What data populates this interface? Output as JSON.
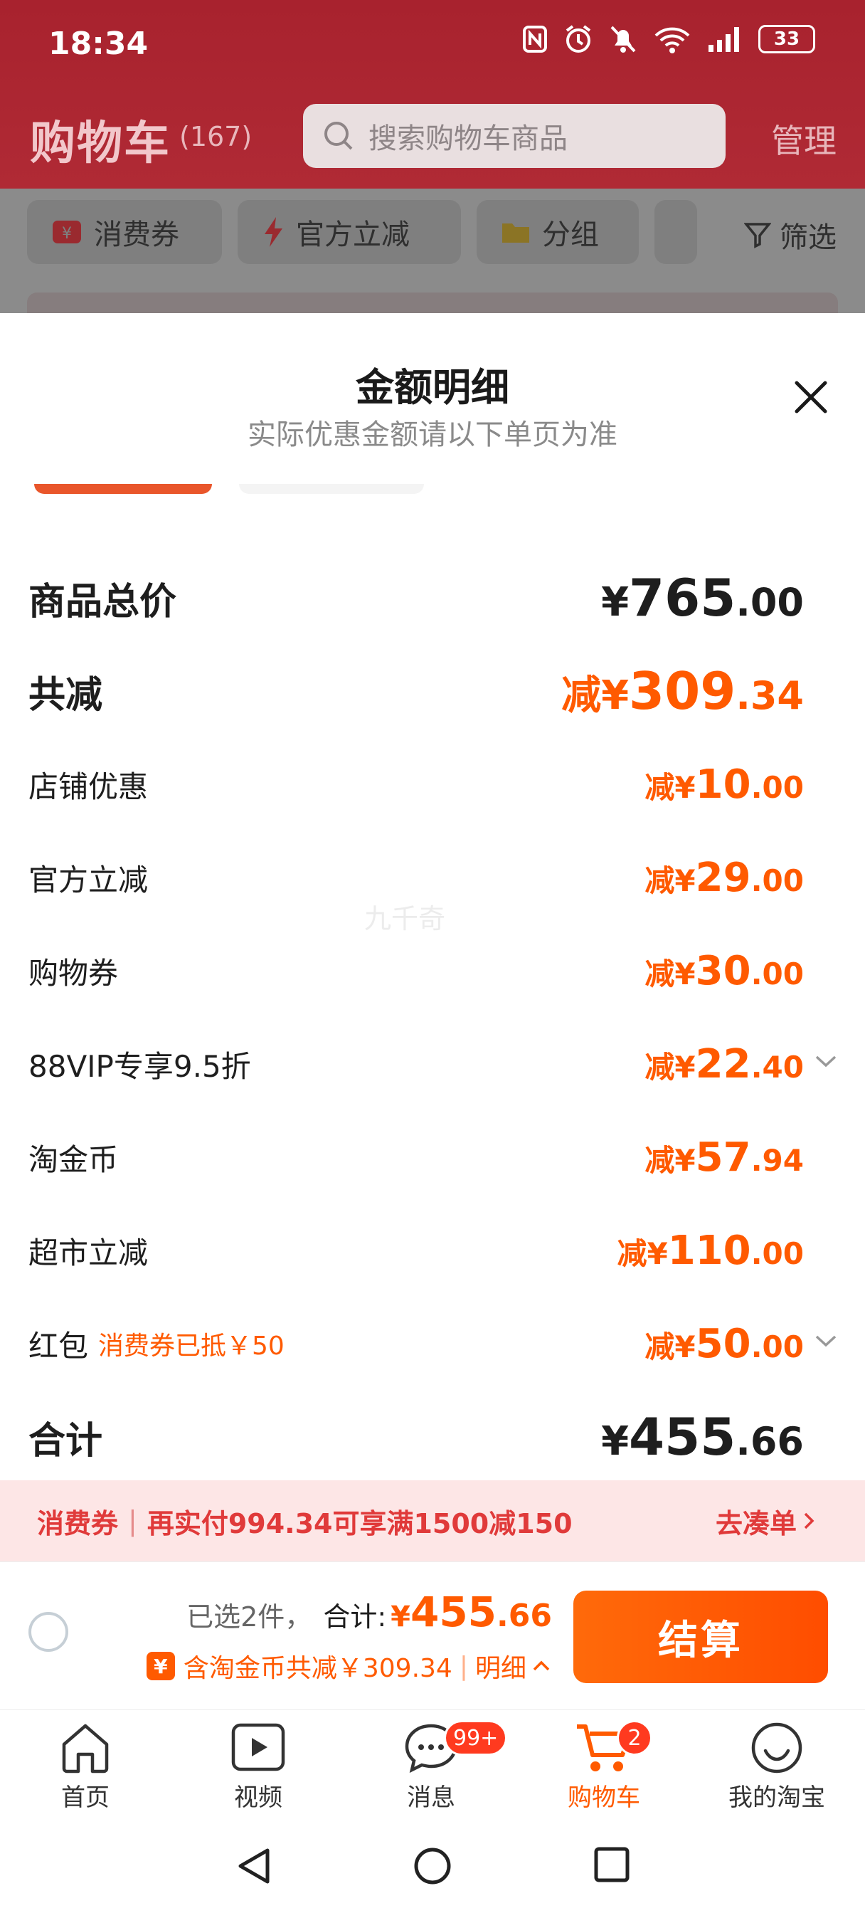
{
  "status_bar": {
    "time": "18:34",
    "battery": "33"
  },
  "header": {
    "title": "购物车",
    "count": "(167)",
    "search_placeholder": "搜索购物车商品",
    "manage": "管理"
  },
  "filters": [
    {
      "label": "消费券",
      "icon": "coupon-icon"
    },
    {
      "label": "官方立减",
      "icon": "lightning-icon"
    },
    {
      "label": "分组",
      "icon": "folder-icon"
    }
  ],
  "filter_right": "筛选",
  "sheet": {
    "title": "金额明细",
    "subtitle": "实际优惠金额请以下单页为准",
    "watermark": "九千奇",
    "rows": [
      {
        "label": "商品总价",
        "prefix": "¥",
        "int": "765",
        "dec": ".00"
      },
      {
        "label": "共减",
        "prefix": "减¥",
        "int": "309",
        "dec": ".34"
      },
      {
        "label": "店铺优惠",
        "prefix": "减¥",
        "int": "10",
        "dec": ".00"
      },
      {
        "label": "官方立减",
        "prefix": "减¥",
        "int": "29",
        "dec": ".00"
      },
      {
        "label": "购物券",
        "prefix": "减¥",
        "int": "30",
        "dec": ".00"
      },
      {
        "label": "88VIP专享9.5折",
        "prefix": "减¥",
        "int": "22",
        "dec": ".40"
      },
      {
        "label": "淘金币",
        "prefix": "减¥",
        "int": "57",
        "dec": ".94"
      },
      {
        "label": "超市立减",
        "prefix": "减¥",
        "int": "110",
        "dec": ".00"
      },
      {
        "label": "红包",
        "note": "消费券已抵￥50",
        "prefix": "减¥",
        "int": "50",
        "dec": ".00"
      },
      {
        "label": "合计",
        "prefix": "¥",
        "int": "455",
        "dec": ".66"
      }
    ]
  },
  "promo": {
    "label": "消费券",
    "text": "再实付994.34可享满1500减150",
    "action": "去凑单"
  },
  "checkout": {
    "selected": "已选2件，",
    "total_label": "合计:",
    "total_prefix": "¥",
    "total_int": "455",
    "total_dec": ".66",
    "badge": "¥",
    "discount_text": "含淘金币共减￥309.34",
    "detail": "明细",
    "button": "结算"
  },
  "tabs": [
    {
      "label": "首页",
      "icon": "home-icon"
    },
    {
      "label": "视频",
      "icon": "video-icon"
    },
    {
      "label": "消息",
      "icon": "message-icon",
      "badge": "99+"
    },
    {
      "label": "购物车",
      "icon": "cart-icon",
      "badge": "2",
      "active": true
    },
    {
      "label": "我的淘宝",
      "icon": "profile-icon"
    }
  ],
  "colors": {
    "accent": "#ff5a00",
    "header": "#a8222e",
    "promo_bg": "#fde6e6"
  }
}
